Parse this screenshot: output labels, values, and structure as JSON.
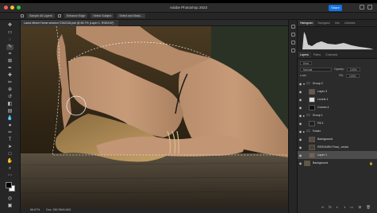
{
  "app": {
    "title": "Adobe Photoshop 2023",
    "share_label": "Share"
  },
  "options_bar": {
    "sample_all_layers": "Sample All Layers",
    "enhance_edge": "Enhance Edge",
    "select_subject": "Select Subject",
    "select_and_mask": "Select and Mask..."
  },
  "document": {
    "tab_title": "Laura Mineri Home session ©162118.psb @ 66.7% (Layer 1, RGB/16*)"
  },
  "status": {
    "zoom": "66.67%",
    "doc_size": "Doc: 282.9M/4.84G"
  },
  "panels": {
    "tabs_top": [
      "Histogram",
      "Navigator",
      "Info",
      "Libraries"
    ],
    "tabs_layers": [
      "Layers",
      "Paths",
      "Channels"
    ],
    "kind_label": "Kind",
    "blend_mode": "Normal",
    "opacity": "100%",
    "fill": "100%",
    "lock_label": "Lock:"
  },
  "layers": [
    {
      "name": "Group 2",
      "type": "group"
    },
    {
      "name": "Layer 3",
      "type": "pixel"
    },
    {
      "name": "Levels 1",
      "type": "adjustment"
    },
    {
      "name": "Curves 4",
      "type": "adjustment"
    },
    {
      "name": "Group 1",
      "type": "group"
    },
    {
      "name": "Fill 1",
      "type": "fill"
    },
    {
      "name": "Folder",
      "type": "group"
    },
    {
      "name": "Background",
      "type": "pixel"
    },
    {
      "name": "RESONEN Final_ vector",
      "type": "pixel"
    },
    {
      "name": "Layer 1",
      "type": "pixel",
      "selected": true
    },
    {
      "name": "Background",
      "type": "pixel",
      "locked": true
    }
  ],
  "colors": {
    "accent": "#1473e6",
    "selection": "#4d4d4d",
    "panel_bg": "#2b2b2b"
  }
}
